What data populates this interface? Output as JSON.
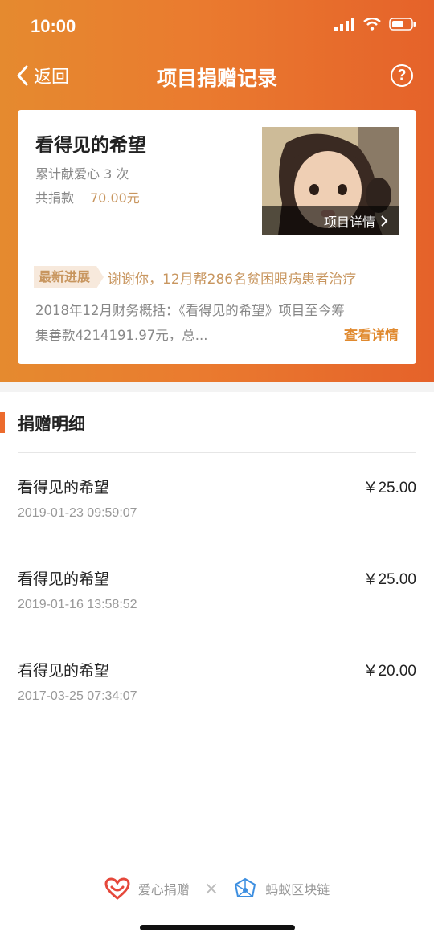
{
  "status_bar": {
    "time": "10:00"
  },
  "nav": {
    "back_label": "返回",
    "title": "项目捐赠记录",
    "help_symbol": "?"
  },
  "project_card": {
    "title": "看得见的希望",
    "count_text": "累计献爱心 3 次",
    "total_label": "共捐款",
    "total_value": "70.00元",
    "photo_detail_label": "项目详情",
    "progress_tag": "最新进展",
    "progress_text": "谢谢你，12月帮286名贫困眼病患者治疗",
    "summary_line1": "2018年12月财务概括：《看得见的希望》项目至今筹",
    "summary_line2": "集善款4214191.97元，总...",
    "more_label": "查看详情"
  },
  "details": {
    "section_title": "捐赠明细",
    "rows": [
      {
        "name": "看得见的希望",
        "amount": "￥25.00",
        "time": "2019-01-23 09:59:07"
      },
      {
        "name": "看得见的希望",
        "amount": "￥25.00",
        "time": "2019-01-16 13:58:52"
      },
      {
        "name": "看得见的希望",
        "amount": "￥20.00",
        "time": "2017-03-25 07:34:07"
      }
    ]
  },
  "footer": {
    "left_brand": "爱心捐赠",
    "separator": "×",
    "right_brand": "蚂蚁区块链"
  },
  "colors": {
    "header_orange": "#ea7b2f",
    "accent_gold": "#c8965f",
    "link_orange": "#e0892e",
    "brand_red": "#e5483b",
    "chain_blue": "#3c8ee0"
  }
}
